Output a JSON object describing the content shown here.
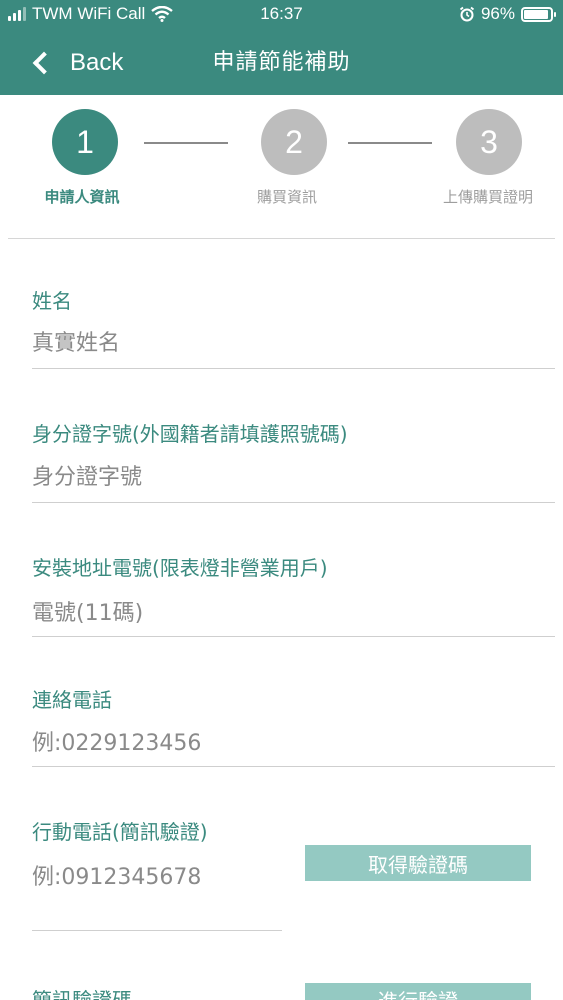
{
  "status_bar": {
    "carrier": "TWM WiFi Call",
    "time": "16:37",
    "battery": "96%"
  },
  "nav": {
    "back_label": "Back",
    "title": "申請節能補助"
  },
  "steps": [
    {
      "number": "1",
      "label": "申請人資訊",
      "state": "active"
    },
    {
      "number": "2",
      "label": "購買資訊",
      "state": "inactive"
    },
    {
      "number": "3",
      "label": "上傳購買證明",
      "state": "inactive"
    }
  ],
  "form": {
    "name": {
      "label": "姓名",
      "placeholder": "真實姓名"
    },
    "id_number": {
      "label": "身分證字號(外國籍者請填護照號碼)",
      "placeholder": "身分證字號"
    },
    "meter_number": {
      "label": "安裝地址電號(限表燈非營業用戶)",
      "placeholder": "電號(11碼)"
    },
    "contact_phone": {
      "label": "連絡電話",
      "placeholder": "例:0229123456"
    },
    "mobile_phone": {
      "label": "行動電話(簡訊驗證)",
      "placeholder": "例:0912345678",
      "button": "取得驗證碼"
    },
    "sms_code": {
      "label": "簡訊驗證碼",
      "button": "進行驗證"
    }
  },
  "colors": {
    "primary": "#3b8a7f",
    "button_disabled": "#94c9c2",
    "step_inactive": "#bdbdbd"
  }
}
